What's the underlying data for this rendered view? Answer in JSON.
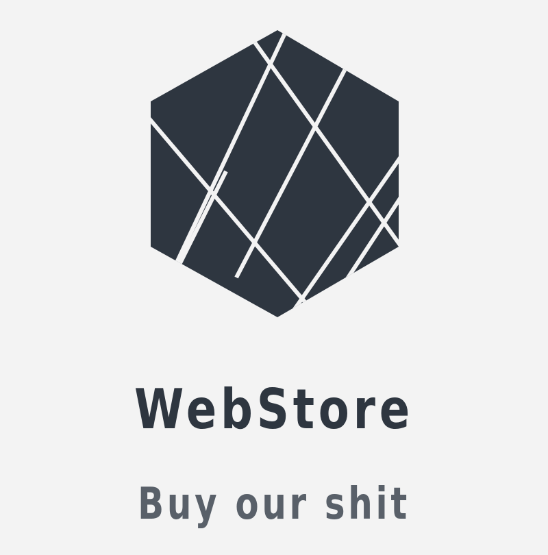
{
  "brand": {
    "name": "WebStore",
    "tagline": "Buy our shit"
  },
  "colors": {
    "background": "#f3f3f3",
    "mark": "#2e3640",
    "name": "#2e3640",
    "tagline": "#596069"
  },
  "icons": {
    "logo": "faceted-hexagon-icon"
  }
}
